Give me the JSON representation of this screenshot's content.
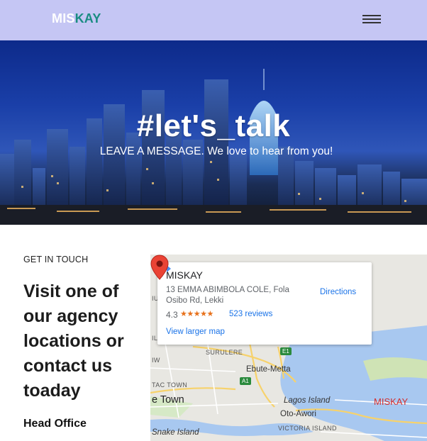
{
  "navbar": {
    "logo_part1": "MIS",
    "logo_part2": "KAY",
    "menu_icon": "hamburger-menu-icon",
    "background": "#c5c6f4",
    "logo_accent": "#1a8c82"
  },
  "hero": {
    "title": "#let's_talk",
    "subtitle": "LEAVE A MESSAGE. We love to hear from you!"
  },
  "contact": {
    "eyebrow": "GET IN TOUCH",
    "heading": "Visit one of our agency locations or contact us toaday",
    "office_label": "Head Office"
  },
  "map": {
    "card": {
      "name": "MISKAY",
      "address": "13 EMMA ABIMBOLA COLE, Fola Osibo Rd, Lekki",
      "rating": "4.3",
      "stars": "★★★★★",
      "reviews": "523 reviews",
      "larger_map": "View larger map",
      "directions": "Directions",
      "directions_icon": "directions-arrow-icon"
    },
    "pin_label": "MISKAY",
    "labels": {
      "surulere": "SURULERE",
      "ebute": "Ebute-Metta",
      "tac_town": "TAC TOWN",
      "e_town": "e Town",
      "lagos_island": "Lagos Island",
      "oto_awori": "Oto-Awori",
      "victoria": "VICTORIA ISLAND",
      "snake_island": "Snake Island",
      "ilo": "ILO",
      "iw": "IW",
      "iu": "IU"
    },
    "road_badges": [
      "E1",
      "A1"
    ],
    "pin_color": "#ea4335",
    "water_color": "#a8c8f0"
  }
}
